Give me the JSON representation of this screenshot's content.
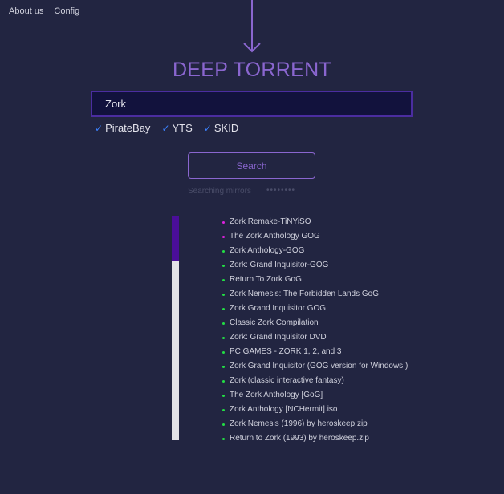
{
  "nav": {
    "about": "About us",
    "config": "Config"
  },
  "header": {
    "arrow_icon": "down-arrow-icon",
    "title": "DEEP TORRENT"
  },
  "search": {
    "value": "Zork",
    "button_label": "Search"
  },
  "sources": [
    {
      "label": "PirateBay",
      "checked": true
    },
    {
      "label": "YTS",
      "checked": true
    },
    {
      "label": "SKID",
      "checked": true
    }
  ],
  "status": {
    "text": "Searching mirrors",
    "dots": "••••••••"
  },
  "scroll": {
    "position_fraction": 0.0,
    "visible_fraction": 0.2
  },
  "colors": {
    "background": "#222541",
    "accent": "#8a66cf",
    "check": "#3b82ff",
    "dot_green": "#22dd44",
    "dot_magenta": "#dd22dd"
  },
  "results": [
    {
      "title": "Zork Remake-TiNYiSO",
      "dot": "#dd22dd"
    },
    {
      "title": "The Zork Anthology GOG",
      "dot": "#dd22dd"
    },
    {
      "title": "Zork Anthology-GOG",
      "dot": "#22dd44"
    },
    {
      "title": "Zork: Grand Inquisitor-GOG",
      "dot": "#22dd44"
    },
    {
      "title": "Return To Zork GoG",
      "dot": "#22dd44"
    },
    {
      "title": "Zork Nemesis: The Forbidden Lands GoG",
      "dot": "#22dd44"
    },
    {
      "title": "Zork Grand Inquisitor GOG",
      "dot": "#22dd44"
    },
    {
      "title": "Classic Zork Compilation",
      "dot": "#22dd44"
    },
    {
      "title": "Zork: Grand Inquisitor DVD",
      "dot": "#22dd44"
    },
    {
      "title": "PC GAMES - ZORK 1, 2, and 3",
      "dot": "#22dd44"
    },
    {
      "title": "Zork Grand Inquisitor (GOG version for Windows!)",
      "dot": "#22dd44"
    },
    {
      "title": "Zork (classic interactive fantasy)",
      "dot": "#22dd44"
    },
    {
      "title": "The Zork Anthology [GoG]",
      "dot": "#22dd44"
    },
    {
      "title": "Zork Anthology [NCHermit].iso",
      "dot": "#22dd44"
    },
    {
      "title": "Zork Nemesis (1996) by heroskeep.zip",
      "dot": "#22dd44"
    },
    {
      "title": "Return to Zork (1993) by heroskeep.zip",
      "dot": "#22dd44"
    }
  ]
}
